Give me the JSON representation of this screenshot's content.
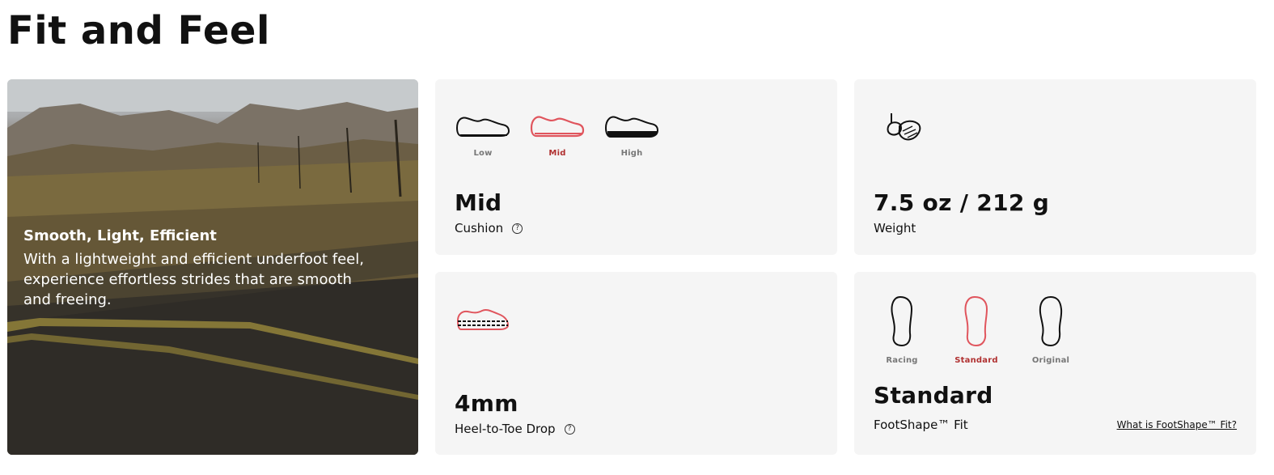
{
  "page": {
    "title": "Fit and Feel"
  },
  "hero": {
    "heading": "Smooth, Light, Efficient",
    "body": "With a lightweight and efficient underfoot feel, experience effortless strides that are smooth and freeing."
  },
  "cushion": {
    "options": [
      {
        "label": "Low",
        "icon": "low-cushion-shoe-icon",
        "active": false
      },
      {
        "label": "Mid",
        "icon": "mid-cushion-shoe-icon",
        "active": true
      },
      {
        "label": "High",
        "icon": "high-cushion-shoe-icon",
        "active": false
      }
    ],
    "value": "Mid",
    "label": "Cushion",
    "help_symbol": "?"
  },
  "weight": {
    "icon": "feather-icon",
    "value": "7.5 oz / 212 g",
    "label": "Weight"
  },
  "drop": {
    "icon": "heel-toe-drop-shoe-icon",
    "value": "4mm",
    "label": "Heel-to-Toe Drop",
    "help_symbol": "?"
  },
  "fit": {
    "options": [
      {
        "label": "Racing",
        "icon": "racing-footshape-icon",
        "active": false
      },
      {
        "label": "Standard",
        "icon": "standard-footshape-icon",
        "active": true
      },
      {
        "label": "Original",
        "icon": "original-footshape-icon",
        "active": false
      }
    ],
    "value": "Standard",
    "label": "FootShape™ Fit",
    "link": "What is FootShape™ Fit?"
  },
  "colors": {
    "accent": "#e0555d",
    "accent_text": "#b03030",
    "card_bg": "#f5f5f5"
  }
}
